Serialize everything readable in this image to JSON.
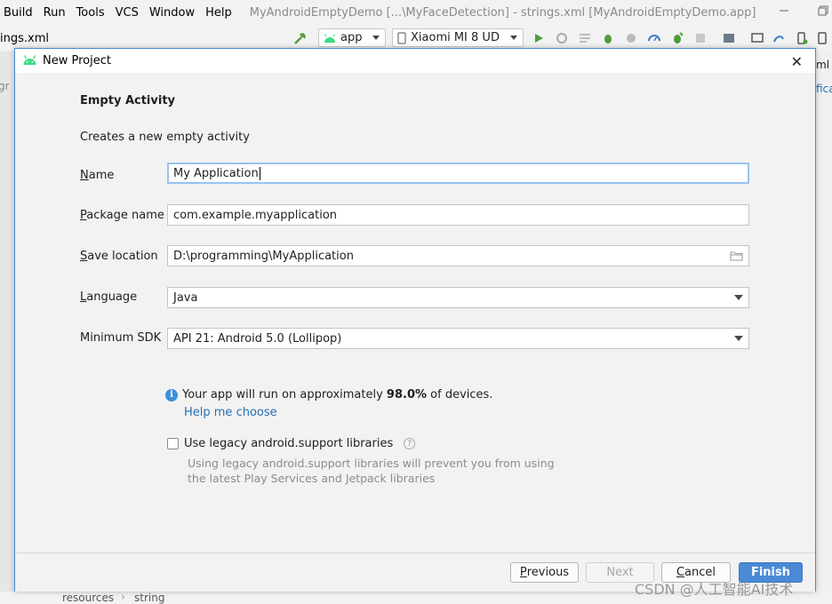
{
  "ide": {
    "menu": [
      "Build",
      "Run",
      "Tools",
      "VCS",
      "Window",
      "Help"
    ],
    "window_title": "MyAndroidEmptyDemo [...\\MyFaceDetection] - strings.xml [MyAndroidEmptyDemo.app]",
    "file_tab": "ings.xml",
    "run_config": "app",
    "device": "Xiaomi MI 8 UD",
    "left_edge_text": "gr",
    "right_edge_tab": "ml",
    "right_edge_text": "fica",
    "breadcrumb": [
      "resources",
      "string"
    ]
  },
  "dialog": {
    "title": "New Project",
    "heading": "Empty Activity",
    "subheading": "Creates a new empty activity",
    "fields": {
      "name": {
        "label_u": "N",
        "label_rest": "ame",
        "value": "My Application"
      },
      "package": {
        "label_u": "P",
        "label_rest": "ackage name",
        "value": "com.example.myapplication"
      },
      "save_location": {
        "label_u": "S",
        "label_rest": "ave location",
        "value": "D:\\programming\\MyApplication"
      },
      "language": {
        "label_u": "L",
        "label_rest": "anguage",
        "value": "Java"
      },
      "min_sdk": {
        "label": "Minimum SDK",
        "value": "API 21: Android 5.0 (Lollipop)"
      }
    },
    "info": {
      "prefix": "Your app will run on approximately ",
      "percent": "98.0%",
      "suffix": " of devices.",
      "help_link": "Help me choose"
    },
    "legacy": {
      "label": "Use legacy android.support libraries",
      "checked": false,
      "description": "Using legacy android.support libraries will prevent you from using the latest Play Services and Jetpack libraries"
    },
    "buttons": {
      "previous_u": "P",
      "previous_rest": "revious",
      "next": "Next",
      "cancel_u": "C",
      "cancel_rest": "ancel",
      "finish": "Finish"
    }
  },
  "watermark": "CSDN @人工智能AI技术",
  "colors": {
    "accent": "#4a8ad6",
    "link": "#2470b3",
    "android_green": "#3ddc84",
    "info_blue": "#3d8fd9"
  }
}
